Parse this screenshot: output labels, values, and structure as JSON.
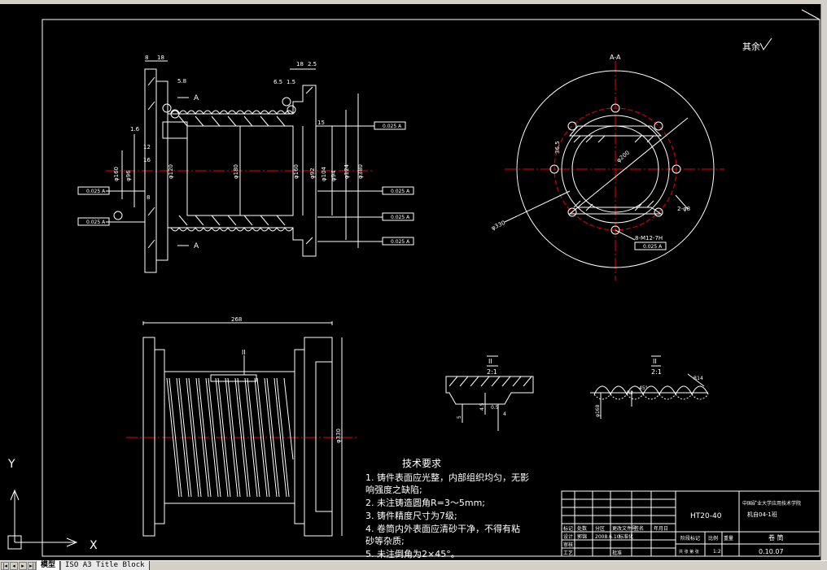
{
  "tabs": [
    {
      "label": "模型",
      "active": true
    },
    {
      "label": "ISO A3 Title Block",
      "active": false
    }
  ],
  "nav_buttons": [
    "|◂",
    "◂",
    "▸",
    "▸|"
  ],
  "ucs": {
    "x_label": "X",
    "y_label": "Y"
  },
  "drawing": {
    "rough_note": "其余",
    "section_label": "A-A",
    "section_arrow_label": "A",
    "detail_label": "II",
    "detail_scale": "2:1",
    "dims_left": [
      "8",
      "18",
      "5.8",
      "18",
      "2.5",
      "6.5",
      "1.5",
      "15",
      "12",
      "1.6",
      "16",
      "8",
      "φ160",
      "φ96",
      "φ120",
      "φ180",
      "φ160",
      "φ92",
      "φ94",
      "φ104",
      "φ124",
      "φ380"
    ],
    "dims_section": [
      "φ330",
      "φ200",
      "36.5",
      "2-φ8",
      "8-M12-7H"
    ],
    "dim_overall_length": "268",
    "dim_overall_dia": "φ330",
    "tol_frames": [
      "0.025 A",
      "0.025 A",
      "0.025 A",
      "0.025 A",
      "0.025 A",
      "0.025 A",
      "0.025 A"
    ],
    "detail_dims": [
      "5",
      "4.5",
      "0.5",
      "4",
      "R14",
      "45°",
      "φ168",
      "R2"
    ],
    "tech_req_title": "技术要求",
    "tech_req": [
      "1. 铸件表面应光整，内部组织均匀，无影",
      "    响强度之缺陷;",
      "2. 未注铸造圆角R=3～5mm;",
      "3. 铸件精度尺寸为7级;",
      "4. 卷筒内外表面应清砂干净，不得有粘",
      "    砂等杂质;",
      "5. 未注倒角为2×45°。"
    ]
  },
  "title_block": {
    "material": "HT20-40",
    "school": "中国矿业大学应用技术学院",
    "class": "机自04-1班",
    "part_name": "卷 筒",
    "drawing_no": "0.10.07",
    "scale": "1:2",
    "stage_label": "阶段标记",
    "weight_label": "重量",
    "scale_label": "比例",
    "row_labels": [
      "标记",
      "处数",
      "分区",
      "更改文件号",
      "签名",
      "年月日"
    ],
    "designer_label": "设计",
    "designer": "郭锦",
    "date": "2008.6.10",
    "std_label": "标准化",
    "review_label": "审核",
    "craft_label": "工艺",
    "approve_label": "批准",
    "sheet_label": "共 张 第 张"
  }
}
